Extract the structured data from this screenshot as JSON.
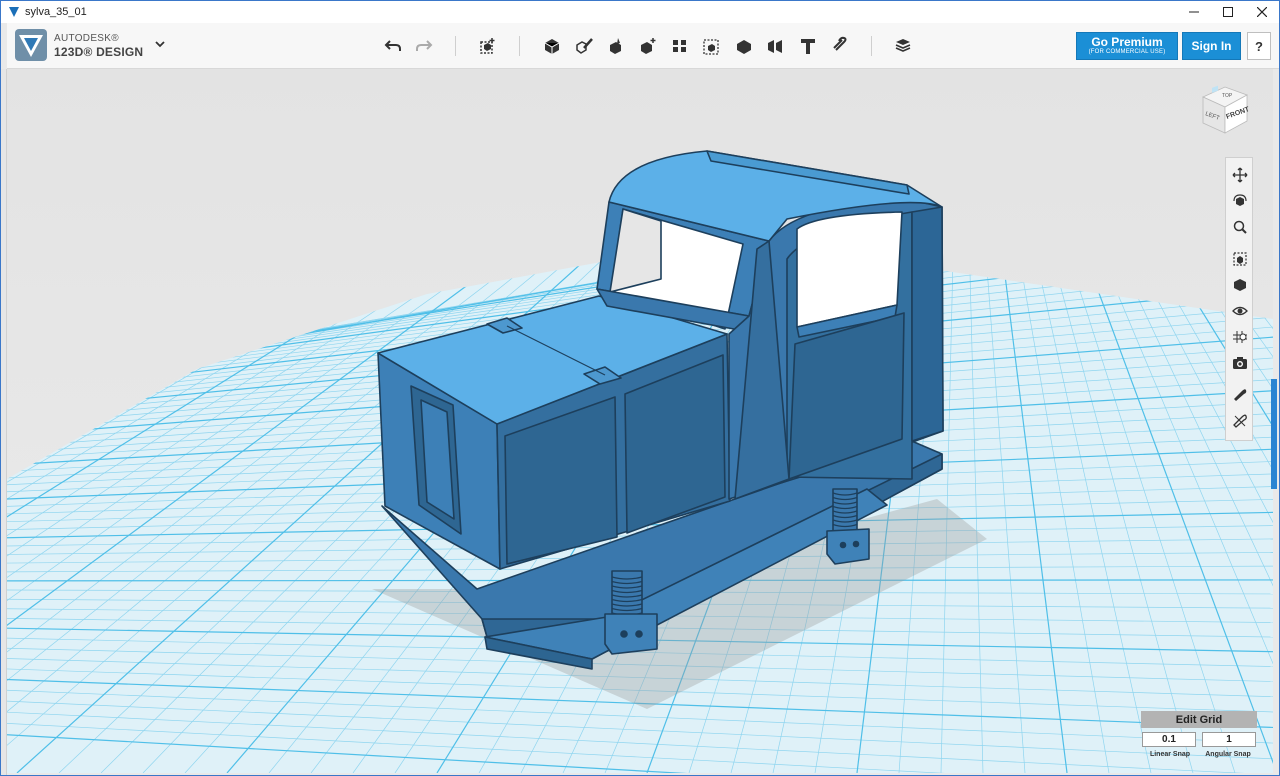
{
  "window": {
    "title": "sylva_35_01",
    "controls": [
      "minimize",
      "maximize",
      "close"
    ]
  },
  "brand": {
    "line1": "AUTODESK®",
    "line2": "123D® DESIGN"
  },
  "toolbar": {
    "icons": [
      "undo-icon",
      "redo-icon",
      "primitives-icon",
      "sketch-icon",
      "construct-icon",
      "modify-icon",
      "pattern-icon",
      "grouping-icon",
      "combine-icon",
      "measure-icon",
      "text-icon",
      "snap-icon",
      "material-icon"
    ],
    "go_premium_label": "Go Premium",
    "go_premium_sub": "(FOR COMMERCIAL USE)",
    "sign_in_label": "Sign In",
    "help_label": "?"
  },
  "viewcube": {
    "faces": [
      "TOP",
      "LEFT",
      "FRONT"
    ]
  },
  "navbar": {
    "icons": [
      "pan-icon",
      "orbit-icon",
      "zoom-icon",
      "fit-icon",
      "view-mode-icon",
      "visibility-icon",
      "grid-visibility-icon",
      "snapshot-icon",
      "material-icon",
      "outline-icon"
    ]
  },
  "edit_grid": {
    "button_label": "Edit Grid",
    "linear_snap_value": "0.1",
    "linear_snap_label": "Linear Snap",
    "angular_snap_value": "1",
    "angular_snap_label": "Angular Snap"
  },
  "colors": {
    "accent": "#1b8fd6",
    "model_top": "#5aaee6",
    "model_side": "#3a7fb8",
    "model_dark": "#2c6696",
    "grid": "#5bc4ea",
    "grid_bg": "#d9eef6"
  }
}
